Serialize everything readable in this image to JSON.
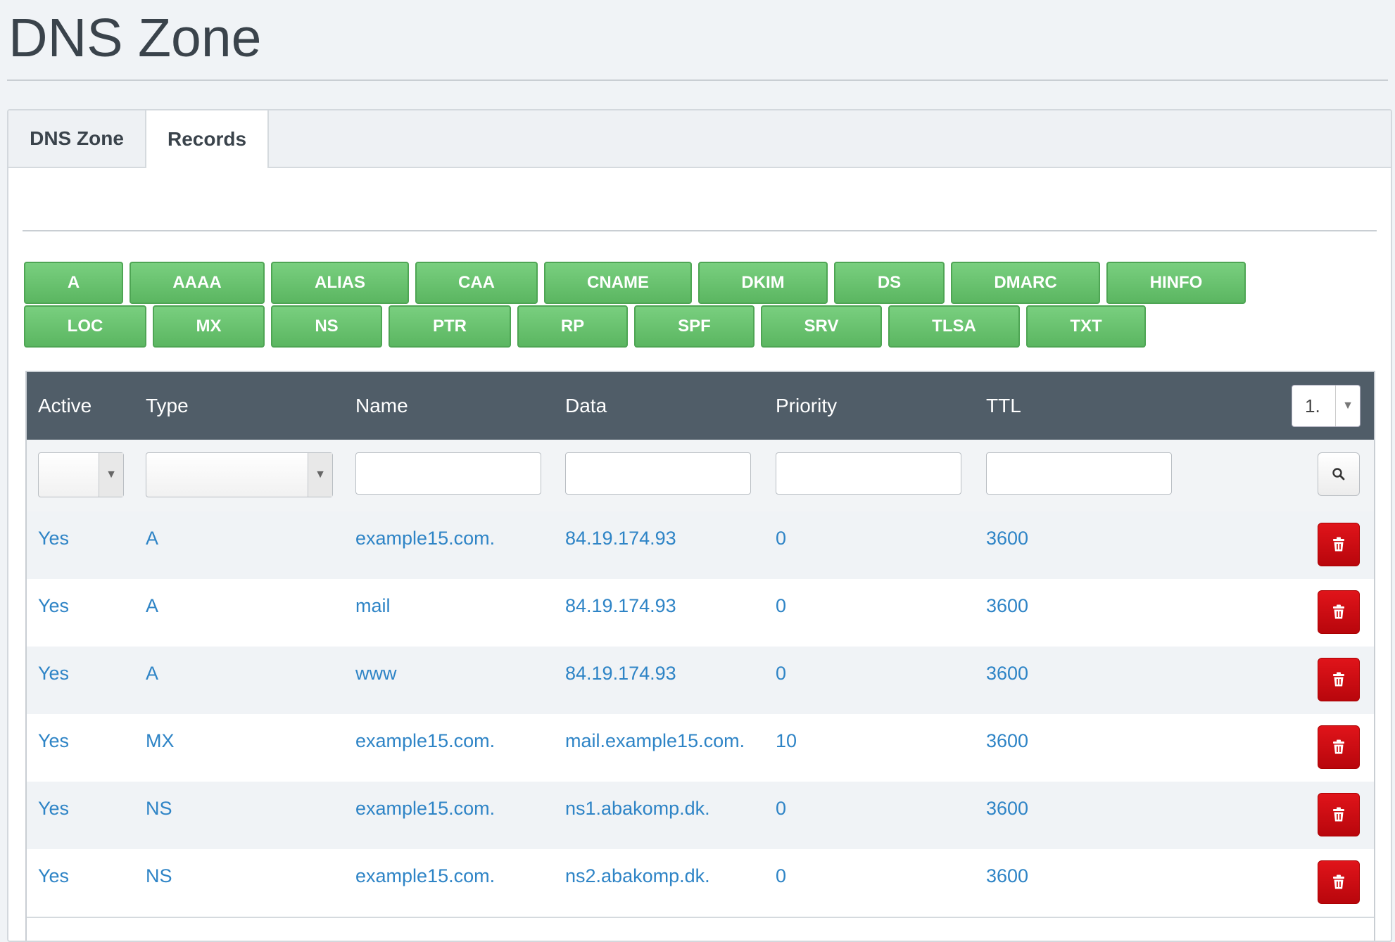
{
  "page": {
    "title": "DNS Zone"
  },
  "tabs": [
    {
      "label": "DNS Zone",
      "active": false
    },
    {
      "label": "Records",
      "active": true
    }
  ],
  "record_type_buttons": {
    "row1": [
      "A",
      "AAAA",
      "ALIAS",
      "CAA",
      "CNAME",
      "DKIM",
      "DS",
      "DMARC",
      "HINFO"
    ],
    "row2": [
      "LOC",
      "MX",
      "NS",
      "PTR",
      "RP",
      "SPF",
      "SRV",
      "TLSA",
      "TXT"
    ]
  },
  "table": {
    "headers": [
      "Active",
      "Type",
      "Name",
      "Data",
      "Priority",
      "TTL"
    ],
    "page_select": "1.",
    "filters": {
      "active": "",
      "type": "",
      "name": "",
      "data": "",
      "priority": "",
      "ttl": ""
    },
    "rows": [
      {
        "active": "Yes",
        "type": "A",
        "name": "example15.com.",
        "data": "84.19.174.93",
        "priority": "0",
        "ttl": "3600"
      },
      {
        "active": "Yes",
        "type": "A",
        "name": "mail",
        "data": "84.19.174.93",
        "priority": "0",
        "ttl": "3600"
      },
      {
        "active": "Yes",
        "type": "A",
        "name": "www",
        "data": "84.19.174.93",
        "priority": "0",
        "ttl": "3600"
      },
      {
        "active": "Yes",
        "type": "MX",
        "name": "example15.com.",
        "data": "mail.example15.com.",
        "priority": "10",
        "ttl": "3600"
      },
      {
        "active": "Yes",
        "type": "NS",
        "name": "example15.com.",
        "data": "ns1.abakomp.dk.",
        "priority": "0",
        "ttl": "3600"
      },
      {
        "active": "Yes",
        "type": "NS",
        "name": "example15.com.",
        "data": "ns2.abakomp.dk.",
        "priority": "0",
        "ttl": "3600"
      }
    ]
  },
  "icons": {
    "search": "search-icon",
    "delete": "trash-icon",
    "dropdown": "caret-down-icon"
  },
  "colors": {
    "add_button": "#5bb661",
    "header": "#505d68",
    "link": "#2e84c6",
    "delete": "#c90a10"
  }
}
